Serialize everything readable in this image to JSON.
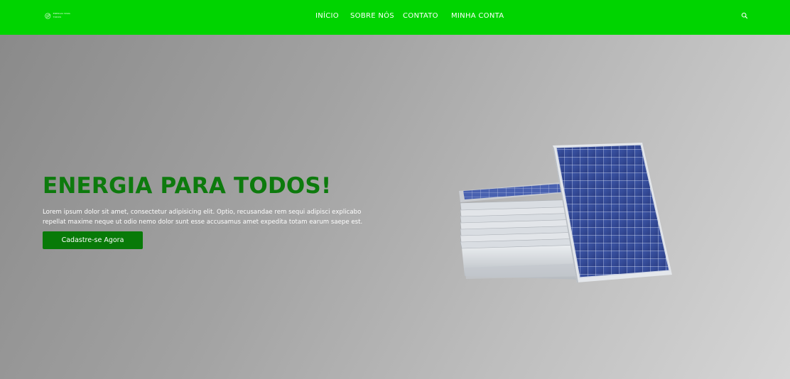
{
  "header": {
    "logo": {
      "icon": "globe-leaf-icon",
      "text_lines": [
        "ENERGIA PARA",
        "TODOS"
      ]
    },
    "nav": [
      {
        "label": "INÍCIO"
      },
      {
        "label": "SOBRE NÓS"
      },
      {
        "label": "CONTATO"
      },
      {
        "label": "MINHA CONTA"
      }
    ],
    "search_icon": "search-icon",
    "background_color": "#00d400"
  },
  "hero": {
    "title": "ENERGIA PARA TODOS!",
    "text_line_1": "Lorem ipsum dolor sit amet, consectetur adipisicing elit. Optio, recusandae rem sequi adipisci explicabo",
    "text_line_2": "repellat maxime neque ut odio nemo dolor sunt esse accusamus amet expedita totam earum saepe est.",
    "cta_label": "Cadastre-se Agora",
    "title_color": "#0d7a0d",
    "cta_color": "#087a08",
    "image": "solar-panels-image"
  }
}
